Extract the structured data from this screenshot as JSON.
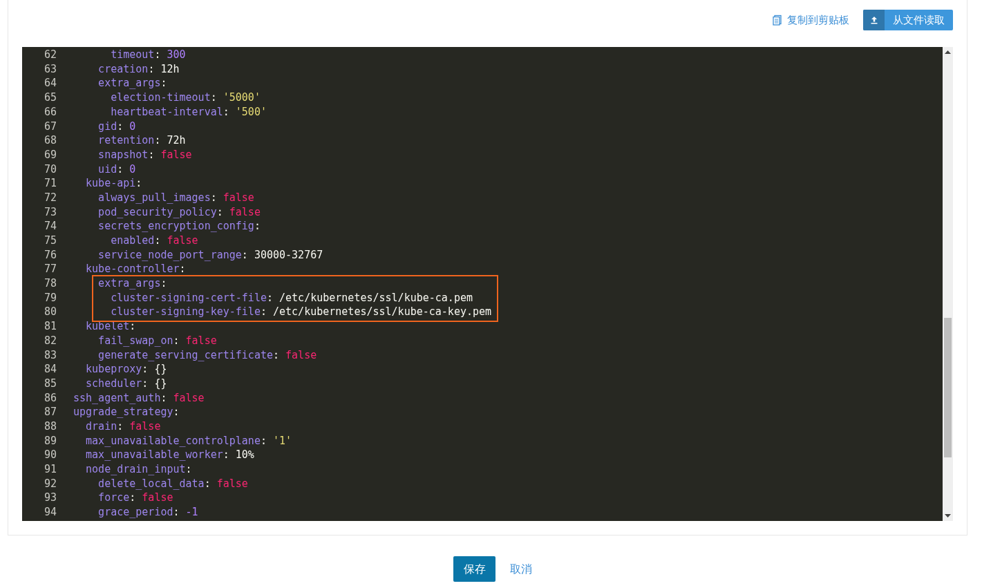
{
  "toolbar": {
    "copy_link": "复制到剪贴板",
    "read_file_button": "从文件读取"
  },
  "editor": {
    "lines": [
      {
        "number": "62",
        "key": "      timeout",
        "sep": ":",
        "value": "300",
        "kind": "number",
        "boxed": false
      },
      {
        "number": "63",
        "key": "    creation",
        "sep": ":",
        "value": "12h",
        "kind": "plain",
        "boxed": false
      },
      {
        "number": "64",
        "key": "    extra_args",
        "sep": ":",
        "boxed": false
      },
      {
        "number": "65",
        "key": "      election-timeout",
        "sep": ":",
        "value": "'5000'",
        "kind": "string",
        "boxed": false
      },
      {
        "number": "66",
        "key": "      heartbeat-interval",
        "sep": ":",
        "value": "'500'",
        "kind": "string",
        "boxed": false
      },
      {
        "number": "67",
        "key": "    gid",
        "sep": ":",
        "value": "0",
        "kind": "number",
        "boxed": false
      },
      {
        "number": "68",
        "key": "    retention",
        "sep": ":",
        "value": "72h",
        "kind": "plain",
        "boxed": false
      },
      {
        "number": "69",
        "key": "    snapshot",
        "sep": ":",
        "value": "false",
        "kind": "bool",
        "boxed": false
      },
      {
        "number": "70",
        "key": "    uid",
        "sep": ":",
        "value": "0",
        "kind": "number",
        "boxed": false
      },
      {
        "number": "71",
        "key": "  kube-api",
        "sep": ":",
        "boxed": false
      },
      {
        "number": "72",
        "key": "    always_pull_images",
        "sep": ":",
        "value": "false",
        "kind": "bool",
        "boxed": false
      },
      {
        "number": "73",
        "key": "    pod_security_policy",
        "sep": ":",
        "value": "false",
        "kind": "bool",
        "boxed": false
      },
      {
        "number": "74",
        "key": "    secrets_encryption_config",
        "sep": ":",
        "boxed": false
      },
      {
        "number": "75",
        "key": "      enabled",
        "sep": ":",
        "value": "false",
        "kind": "bool",
        "boxed": false
      },
      {
        "number": "76",
        "key": "    service_node_port_range",
        "sep": ":",
        "value": "30000-32767",
        "kind": "plain",
        "boxed": false
      },
      {
        "number": "77",
        "key": "  kube-controller",
        "sep": ":",
        "boxed": false
      },
      {
        "number": "78",
        "key": "    extra_args",
        "sep": ":",
        "boxed": true
      },
      {
        "number": "79",
        "key": "      cluster-signing-cert-file",
        "sep": ":",
        "value": "/etc/kubernetes/ssl/kube-ca.pem",
        "kind": "plain",
        "boxed": true
      },
      {
        "number": "80",
        "key": "      cluster-signing-key-file",
        "sep": ":",
        "value": "/etc/kubernetes/ssl/kube-ca-key.pem",
        "kind": "plain",
        "boxed": true
      },
      {
        "number": "81",
        "key": "  kubelet",
        "sep": ":",
        "boxed": false
      },
      {
        "number": "82",
        "key": "    fail_swap_on",
        "sep": ":",
        "value": "false",
        "kind": "bool",
        "boxed": false
      },
      {
        "number": "83",
        "key": "    generate_serving_certificate",
        "sep": ":",
        "value": "false",
        "kind": "bool",
        "boxed": false
      },
      {
        "number": "84",
        "key": "  kubeproxy",
        "sep": ":",
        "value": "{}",
        "kind": "plain",
        "boxed": false
      },
      {
        "number": "85",
        "key": "  scheduler",
        "sep": ":",
        "value": "{}",
        "kind": "plain",
        "boxed": false
      },
      {
        "number": "86",
        "key": "ssh_agent_auth",
        "sep": ":",
        "value": "false",
        "kind": "bool",
        "boxed": false
      },
      {
        "number": "87",
        "key": "upgrade_strategy",
        "sep": ":",
        "boxed": false
      },
      {
        "number": "88",
        "key": "  drain",
        "sep": ":",
        "value": "false",
        "kind": "bool",
        "boxed": false
      },
      {
        "number": "89",
        "key": "  max_unavailable_controlplane",
        "sep": ":",
        "value": "'1'",
        "kind": "string",
        "boxed": false
      },
      {
        "number": "90",
        "key": "  max_unavailable_worker",
        "sep": ":",
        "value": "10%",
        "kind": "plain",
        "boxed": false
      },
      {
        "number": "91",
        "key": "  node_drain_input",
        "sep": ":",
        "boxed": false
      },
      {
        "number": "92",
        "key": "    delete_local_data",
        "sep": ":",
        "value": "false",
        "kind": "bool",
        "boxed": false
      },
      {
        "number": "93",
        "key": "    force",
        "sep": ":",
        "value": "false",
        "kind": "bool",
        "boxed": false
      },
      {
        "number": "94",
        "key": "    grace_period",
        "sep": ":",
        "value": "-1",
        "kind": "number",
        "boxed": false
      }
    ]
  },
  "actions": {
    "save_button": "保存",
    "cancel_link": "取消"
  }
}
